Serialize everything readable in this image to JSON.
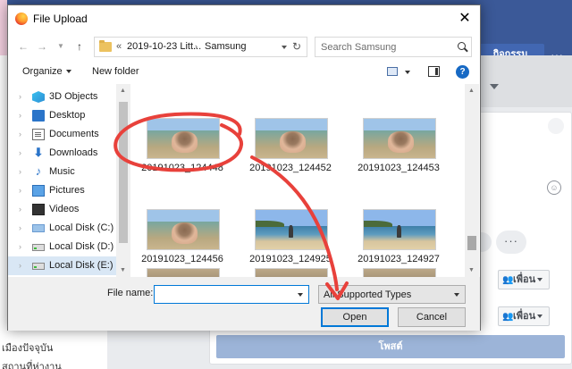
{
  "background": {
    "activity_button": "กิจกรรม",
    "friends_1": "เพื่อน",
    "friends_2": "เพื่อน",
    "post_button": "โพสต์",
    "sidebar_line_1": "เมืองปัจจุบัน",
    "sidebar_line_2": "สถานที่ห่างาน",
    "colors": {
      "topbar": "#3b5998",
      "post": "#9cb4d8",
      "activity": "#4267b2"
    }
  },
  "dialog": {
    "title": "File Upload",
    "address": {
      "overflow": "«",
      "crumbs": [
        "2019-10-23 Litt...",
        "Samsung"
      ],
      "separator": "›"
    },
    "search_placeholder": "Search Samsung",
    "toolbar": {
      "organize": "Organize",
      "new_folder": "New folder",
      "help": "?"
    },
    "nav_items": [
      {
        "label": "3D Objects",
        "icon": "cube-icon"
      },
      {
        "label": "Desktop",
        "icon": "desktop-icon"
      },
      {
        "label": "Documents",
        "icon": "documents-icon"
      },
      {
        "label": "Downloads",
        "icon": "download-icon"
      },
      {
        "label": "Music",
        "icon": "music-icon"
      },
      {
        "label": "Pictures",
        "icon": "pictures-icon"
      },
      {
        "label": "Videos",
        "icon": "videos-icon"
      },
      {
        "label": "Local Disk (C:)",
        "icon": "windows-drive-icon"
      },
      {
        "label": "Local Disk (D:)",
        "icon": "drive-icon"
      },
      {
        "label": "Local Disk (E:)",
        "icon": "drive-icon",
        "selected": true
      }
    ],
    "files": [
      {
        "name": "20191023_124448",
        "kind": "hands"
      },
      {
        "name": "20191023_124452",
        "kind": "hands"
      },
      {
        "name": "20191023_124453",
        "kind": "hands"
      },
      {
        "name": "20191023_124456",
        "kind": "hands"
      },
      {
        "name": "20191023_124925",
        "kind": "beach"
      },
      {
        "name": "20191023_124927",
        "kind": "beach"
      }
    ],
    "file_name_label": "File name:",
    "file_name_value": "",
    "file_type": "All Supported Types",
    "open_button": "Open",
    "cancel_button": "Cancel",
    "close_glyph": "✕"
  },
  "annotation": {
    "color": "#e8413b"
  }
}
